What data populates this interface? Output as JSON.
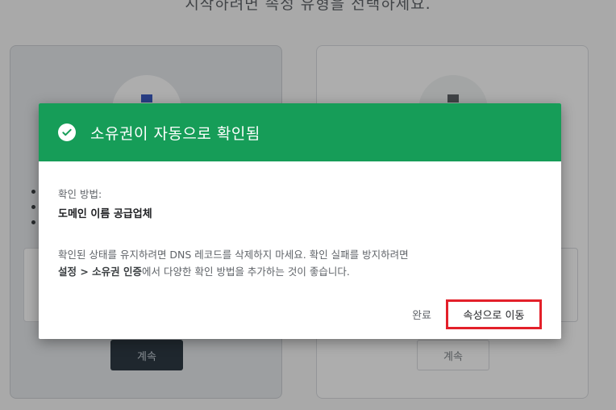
{
  "background": {
    "heading": "시작하려면 속성 유형을 선택하세요.",
    "cards": [
      {
        "continue_label": "계속"
      },
      {
        "continue_label": "계속"
      }
    ]
  },
  "dialog": {
    "title": "소유권이 자동으로 확인됨",
    "header_color": "#169d58",
    "method_label": "확인 방법:",
    "method_value": "도메인 이름 공급업체",
    "desc_line1": "확인된 상태를 유지하려면 DNS 레코드를 삭제하지 마세요. 확인 실패를 방지하려면",
    "desc_line2_bold": "설정 > 소유권 인증",
    "desc_line2_rest": "에서 다양한 확인 방법을 추가하는 것이 좋습니다.",
    "done_label": "완료",
    "goto_label": "속성으로 이동",
    "highlight_color": "#e3202a"
  }
}
